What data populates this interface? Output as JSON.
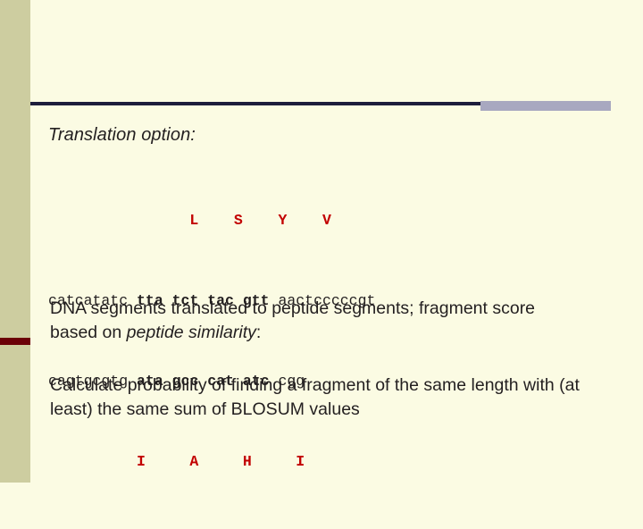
{
  "slide": {
    "heading": "Translation option:",
    "alignment": {
      "top_peptides_line": "                L    S    Y    V",
      "dna_line_1_prefix": "catcatatc ",
      "dna_line_1_bold": "tta tct tac gtt ",
      "dna_line_1_suffix": "aactcccccgt",
      "dna_line_2_prefix": "cagtgcgtg ",
      "dna_line_2_bold": "ata gcc cat atc ",
      "dna_line_2_suffix": "cgg",
      "bottom_peptides_line": "          I     A     H     I"
    },
    "paragraphs": [
      {
        "segments": [
          {
            "text": "DNA segments translated to peptide segments; fragment score based on ",
            "italic": false
          },
          {
            "text": "peptide similarity",
            "italic": true
          },
          {
            "text": ":",
            "italic": false
          }
        ]
      },
      {
        "segments": [
          {
            "text": "Calculate probability of finding a fragment of the same length with (at least) the same sum of BLOSUM values",
            "italic": false
          }
        ]
      }
    ],
    "colors": {
      "background": "#fbfbe3",
      "left_band": "#cdcda0",
      "left_band_accent": "#6b0008",
      "rule_dark": "#1d1d3c",
      "rule_gray": "#a8a8c0",
      "amino_acid": "#c20000",
      "text": "#231f20"
    }
  }
}
